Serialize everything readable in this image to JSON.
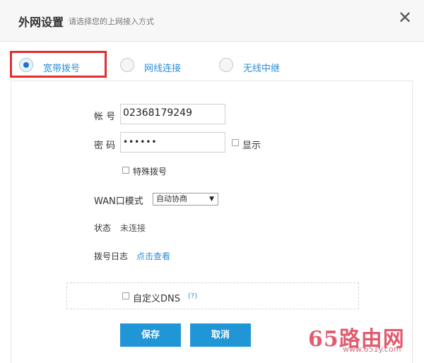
{
  "header": {
    "title": "外网设置",
    "subtitle": "请选择您的上网接入方式",
    "close_label": "✕"
  },
  "tabs": [
    {
      "label": "宽带拨号",
      "selected": true
    },
    {
      "label": "网线连接",
      "selected": false
    },
    {
      "label": "无线中继",
      "selected": false
    }
  ],
  "form": {
    "account_label": "帐 号",
    "account_value": "02368179249",
    "password_label": "密 码",
    "password_value": "••••••",
    "show_label": "显示",
    "special_dial_label": "特殊拨号",
    "wan_mode_label": "WAN口模式",
    "wan_mode_value": "自动协商",
    "status_label": "状态",
    "status_value": "未连接",
    "dial_log_label": "拨号日志",
    "dial_log_link": "点击查看",
    "custom_dns_label": "自定义DNS",
    "dns_help": "(?)"
  },
  "buttons": {
    "save": "保存",
    "cancel": "取消"
  },
  "watermark": {
    "brand": "65路由网",
    "url": "www.651y.com"
  },
  "colors": {
    "accent": "#2196d6",
    "highlight": "#e62d2d",
    "link": "#2a8fd6"
  }
}
